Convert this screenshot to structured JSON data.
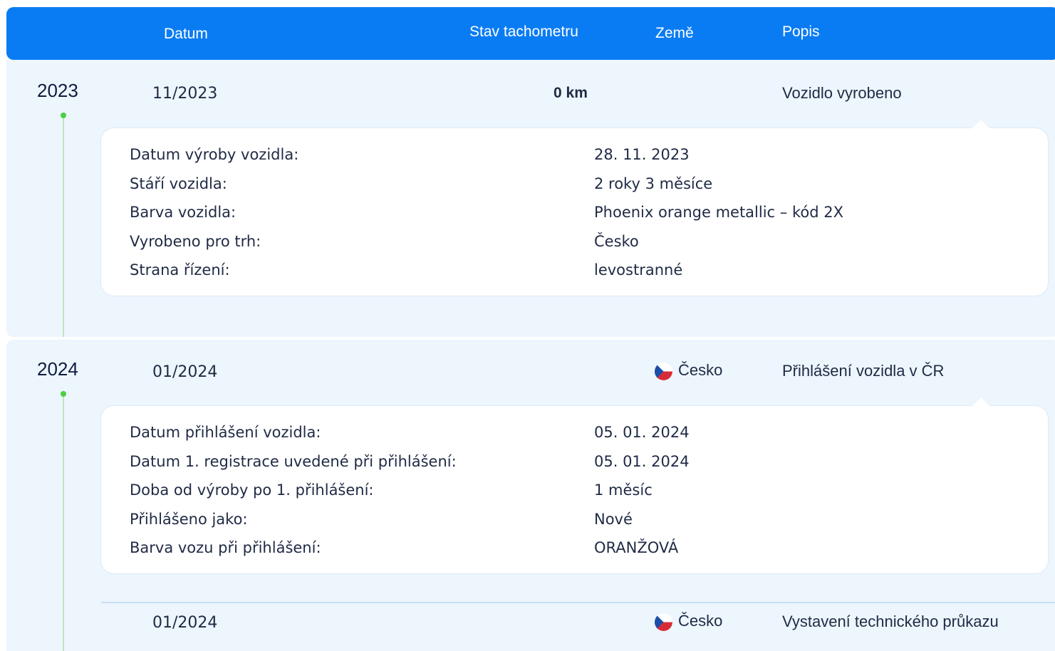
{
  "header": {
    "date": "Datum",
    "odometer": "Stav tachometru",
    "country": "Země",
    "description": "Popis"
  },
  "colors": {
    "header_blue": "#0a7cf3",
    "timeline_green": "#4ccf43",
    "block_bg": "#edf5fd"
  },
  "icons": {
    "country_flag": "czech-flag-icon"
  },
  "timeline": [
    {
      "year": "2023",
      "rows": [
        {
          "date": "11/2023",
          "odometer": "0 km",
          "country": "",
          "description": "Vozidlo vyrobeno",
          "details": [
            {
              "label": "Datum výroby vozidla:",
              "value": "28. 11. 2023"
            },
            {
              "label": "Stáří vozidla:",
              "value": "2 roky 3 měsíce"
            },
            {
              "label": "Barva vozidla:",
              "value": "Phoenix orange metallic – kód 2X"
            },
            {
              "label": "Vyrobeno pro trh:",
              "value": "Česko"
            },
            {
              "label": "Strana řízení:",
              "value": "levostranné"
            }
          ]
        }
      ]
    },
    {
      "year": "2024",
      "rows": [
        {
          "date": "01/2024",
          "odometer": "",
          "country": "Česko",
          "description": "Přihlášení vozidla v ČR",
          "details": [
            {
              "label": "Datum přihlášení vozidla:",
              "value": "05. 01. 2024"
            },
            {
              "label": "Datum 1. registrace uvedené při přihlášení:",
              "value": "05. 01. 2024"
            },
            {
              "label": "Doba od výroby po 1. přihlášení:",
              "value": "1 měsíc"
            },
            {
              "label": "Přihlášeno jako:",
              "value": "Nové"
            },
            {
              "label": "Barva vozu při přihlášení:",
              "value": "ORANŽOVÁ"
            }
          ]
        },
        {
          "date": "01/2024",
          "odometer": "",
          "country": "Česko",
          "description": "Vystavení technického průkazu"
        }
      ]
    }
  ]
}
